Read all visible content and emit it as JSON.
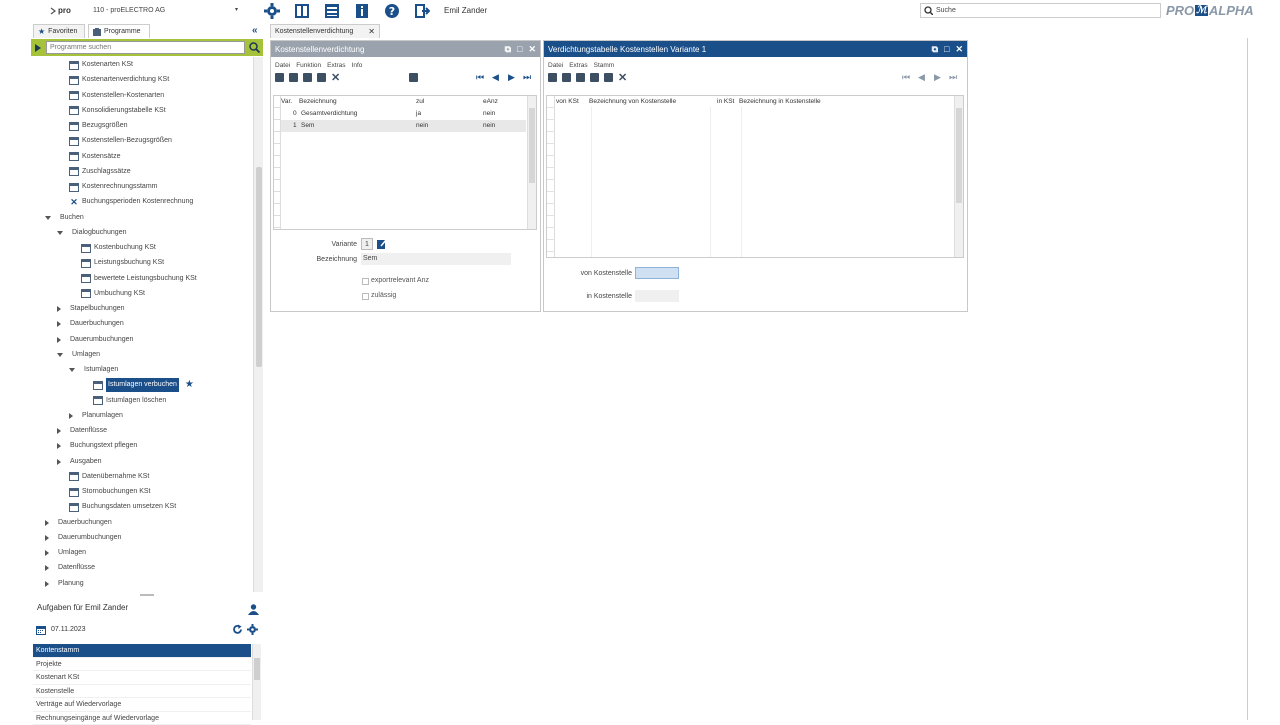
{
  "topbar": {
    "logo_text": "pro",
    "company_select": "110 - proELECTRO AG",
    "user": "Emil Zander",
    "search_placeholder": "Suche",
    "brand_pre": "PRO",
    "brand_mid": "ALPHA"
  },
  "left_tabs": {
    "favorites": "Favoriten",
    "programs": "Programme"
  },
  "program_search": {
    "placeholder": "Programme suchen"
  },
  "tree": {
    "items": [
      {
        "label": "Kostenarten KSt",
        "type": "doc"
      },
      {
        "label": "Kostenartenverdichtung KSt",
        "type": "doc"
      },
      {
        "label": "Kostenstellen-Kostenarten",
        "type": "doc"
      },
      {
        "label": "Konsolidierungstabelle KSt",
        "type": "doc"
      },
      {
        "label": "Bezugsgrößen",
        "type": "doc"
      },
      {
        "label": "Kostenstellen-Bezugsgrößen",
        "type": "doc"
      },
      {
        "label": "Kostensätze",
        "type": "doc"
      },
      {
        "label": "Zuschlagssätze",
        "type": "doc"
      },
      {
        "label": "Kostenrechnungsstamm",
        "type": "doc"
      },
      {
        "label": "Buchungsperioden Kostenrechnung",
        "type": "tool"
      },
      {
        "label": "Buchen",
        "type": "folder-open"
      },
      {
        "label": "Dialogbuchungen",
        "type": "folder-open"
      },
      {
        "label": "Kostenbuchung KSt",
        "type": "doc"
      },
      {
        "label": "Leistungsbuchung KSt",
        "type": "doc"
      },
      {
        "label": "bewertete Leistungsbuchung KSt",
        "type": "doc"
      },
      {
        "label": "Umbuchung KSt",
        "type": "doc"
      },
      {
        "label": "Stapelbuchungen",
        "type": "folder-closed"
      },
      {
        "label": "Dauerbuchungen",
        "type": "folder-closed"
      },
      {
        "label": "Dauerumbuchungen",
        "type": "folder-closed"
      },
      {
        "label": "Umlagen",
        "type": "folder-open"
      },
      {
        "label": "Istumlagen",
        "type": "folder-open"
      },
      {
        "label": "Istumlagen verbuchen",
        "type": "doc-selected"
      },
      {
        "label": "Istumlagen löschen",
        "type": "doc"
      },
      {
        "label": "Planumlagen",
        "type": "folder-closed"
      },
      {
        "label": "Datenflüsse",
        "type": "folder-closed"
      },
      {
        "label": "Buchungstext pflegen",
        "type": "folder-closed"
      },
      {
        "label": "Ausgaben",
        "type": "folder-closed"
      },
      {
        "label": "Datenübernahme KSt",
        "type": "doc"
      },
      {
        "label": "Stornobuchungen KSt",
        "type": "doc"
      },
      {
        "label": "Buchungsdaten umsetzen KSt",
        "type": "doc"
      },
      {
        "label": "Dauerbuchungen",
        "type": "folder-closed"
      },
      {
        "label": "Dauerumbuchungen",
        "type": "folder-closed"
      },
      {
        "label": "Umlagen",
        "type": "folder-closed"
      },
      {
        "label": "Datenflüsse",
        "type": "folder-closed"
      },
      {
        "label": "Planung",
        "type": "folder-closed"
      }
    ]
  },
  "tasks": {
    "title": "Aufgaben für Emil Zander",
    "date": "07.11.2023",
    "items": [
      "Kontenstamm",
      "Projekte",
      "Kostenart KSt",
      "Kostenstelle",
      "Verträge auf Wiedervorlage",
      "Rechnungseingänge auf Wiedervorlage"
    ]
  },
  "window_tab": {
    "label": "Kostenstellenverdichtung"
  },
  "left_panel": {
    "title": "Kostenstellenverdichtung",
    "menu": [
      "Datei",
      "Funktion",
      "Extras",
      "Info"
    ],
    "grid_headers": [
      "Var.",
      "Bezeichnung",
      "zul",
      "eAnz"
    ],
    "rows": [
      {
        "var": "0",
        "bez": "Gesamtverdichtung",
        "zul": "ja",
        "eanz": "nein"
      },
      {
        "var": "1",
        "bez": "Sem",
        "zul": "nein",
        "eanz": "nein"
      }
    ],
    "form": {
      "variante_label": "Variante",
      "variante_value": "1",
      "bezeichnung_label": "Bezeichnung",
      "bezeichnung_value": "Sem",
      "export_label": "exportrelevant Anz",
      "gueltig_label": "zulässig"
    }
  },
  "right_panel": {
    "title": "Verdichtungstabelle Kostenstellen Variante 1",
    "menu": [
      "Datei",
      "Extras",
      "Stamm"
    ],
    "grid_headers": [
      "von KSt",
      "Bezeichnung von Kostenstelle",
      "in KSt",
      "Bezeichnung in Kostenstelle"
    ],
    "form": {
      "von_label": "von Kostenstelle",
      "von_value": "",
      "in_label": "in Kostenstelle",
      "in_value": ""
    }
  }
}
